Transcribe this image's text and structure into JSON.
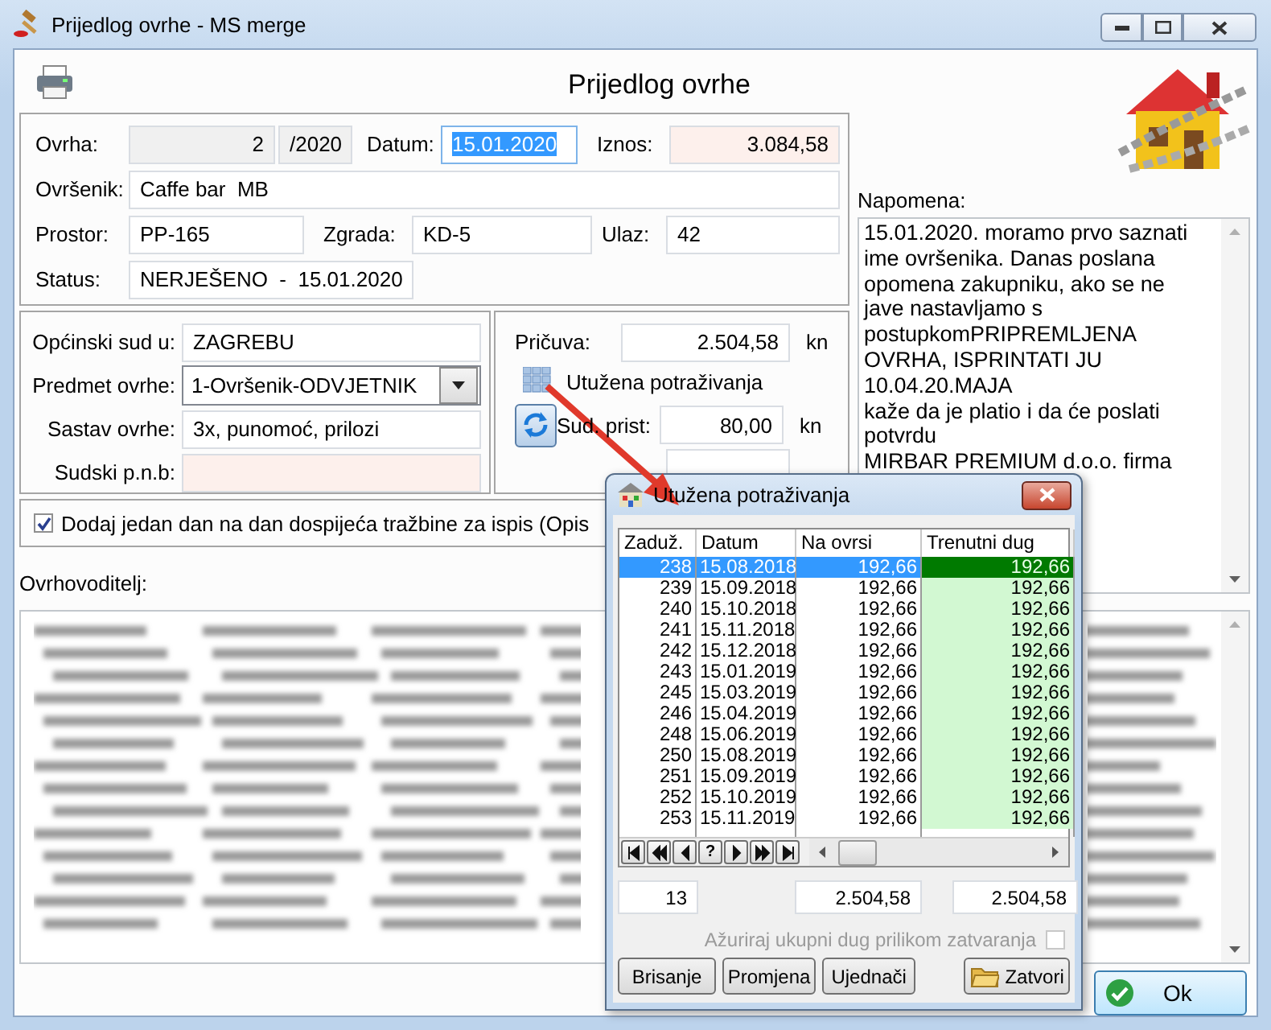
{
  "window": {
    "title": "Prijedlog ovrhe - MS merge"
  },
  "form_title": "Prijedlog ovrhe",
  "case": {
    "ovrha": {
      "label": "Ovrha:",
      "number": "2",
      "year": "/2020"
    },
    "datum": {
      "label": "Datum:",
      "value": "15.01.2020",
      "text_selected": true
    },
    "iznos": {
      "label": "Iznos:",
      "value": "3.084,58"
    },
    "ovrsenik": {
      "label": "Ovršenik:",
      "value": "Caffe bar  MB"
    },
    "prostor": {
      "label": "Prostor:",
      "value": "PP-165"
    },
    "zgrada": {
      "label": "Zgrada:",
      "value": "KD-5"
    },
    "ulaz": {
      "label": "Ulaz:",
      "value": "42"
    },
    "status": {
      "label": "Status:",
      "value": "NERJEŠENO  -  15.01.2020"
    }
  },
  "court": {
    "sud": {
      "label": "Općinski sud u:",
      "value": "ZAGREBU"
    },
    "predmet": {
      "label": "Predmet ovrhe:",
      "value": "1-Ovršenik-ODVJETNIK"
    },
    "sastav": {
      "label": "Sastav ovrhe:",
      "value": "3x, punomoć, prilozi"
    },
    "pnb": {
      "label": "Sudski p.n.b:"
    }
  },
  "costs": {
    "pricuva": {
      "label": "Pričuva:",
      "value": "2.504,58",
      "unit": "kn"
    },
    "link": "Utužena potraživanja",
    "sud_prist": {
      "label": "Sud. prist:",
      "value": "80,00",
      "unit": "kn"
    }
  },
  "add_day": {
    "label": "Dodaj jedan dan na dan dospijeća tražbine za ispis (Opis",
    "checked": true
  },
  "creditor_label": "Ovrhovoditelj:",
  "note": {
    "label": "Napomena:",
    "lines": [
      "15.01.2020. moramo prvo saznati",
      "ime ovršenika. Danas poslana",
      "opomena zakupniku, ako se ne",
      "jave nastavljamo s",
      "postupkomPRIPREMLJENA",
      "OVRHA, ISPRINTATI JU",
      "10.04.20.MAJA",
      "kaže da je platio i da će poslati",
      "potvrdu",
      "MIRBAR PREMIUM d.o.o. firma"
    ]
  },
  "ok_button": "Ok",
  "popup": {
    "title": "Utužena potraživanja",
    "columns": [
      "Zaduž.",
      "Datum",
      "Na ovrsi",
      "Trenutni dug"
    ],
    "rows": [
      {
        "zaduz": "238",
        "datum": "15.08.2018",
        "na_ovrsi": "192,66",
        "trenutni_dug": "192,66",
        "selected": true
      },
      {
        "zaduz": "239",
        "datum": "15.09.2018",
        "na_ovrsi": "192,66",
        "trenutni_dug": "192,66",
        "selected": false
      },
      {
        "zaduz": "240",
        "datum": "15.10.2018",
        "na_ovrsi": "192,66",
        "trenutni_dug": "192,66",
        "selected": false
      },
      {
        "zaduz": "241",
        "datum": "15.11.2018",
        "na_ovrsi": "192,66",
        "trenutni_dug": "192,66",
        "selected": false
      },
      {
        "zaduz": "242",
        "datum": "15.12.2018",
        "na_ovrsi": "192,66",
        "trenutni_dug": "192,66",
        "selected": false
      },
      {
        "zaduz": "243",
        "datum": "15.01.2019",
        "na_ovrsi": "192,66",
        "trenutni_dug": "192,66",
        "selected": false
      },
      {
        "zaduz": "245",
        "datum": "15.03.2019",
        "na_ovrsi": "192,66",
        "trenutni_dug": "192,66",
        "selected": false
      },
      {
        "zaduz": "246",
        "datum": "15.04.2019",
        "na_ovrsi": "192,66",
        "trenutni_dug": "192,66",
        "selected": false
      },
      {
        "zaduz": "248",
        "datum": "15.06.2019",
        "na_ovrsi": "192,66",
        "trenutni_dug": "192,66",
        "selected": false
      },
      {
        "zaduz": "250",
        "datum": "15.08.2019",
        "na_ovrsi": "192,66",
        "trenutni_dug": "192,66",
        "selected": false
      },
      {
        "zaduz": "251",
        "datum": "15.09.2019",
        "na_ovrsi": "192,66",
        "trenutni_dug": "192,66",
        "selected": false
      },
      {
        "zaduz": "252",
        "datum": "15.10.2019",
        "na_ovrsi": "192,66",
        "trenutni_dug": "192,66",
        "selected": false
      },
      {
        "zaduz": "253",
        "datum": "15.11.2019",
        "na_ovrsi": "192,66",
        "trenutni_dug": "192,66",
        "selected": false
      }
    ],
    "pager_help": "?",
    "totals": {
      "count": "13",
      "na_ovrsi": "2.504,58",
      "trenutni_dug": "2.504,58"
    },
    "update_option": {
      "label": "Ažuriraj ukupni dug prilikom zatvaranja",
      "checked": false,
      "disabled": true
    },
    "buttons": [
      {
        "kind": "plain",
        "label": "Brisanje"
      },
      {
        "kind": "plain",
        "label": "Promjena"
      },
      {
        "kind": "plain",
        "label": "Ujednači"
      },
      {
        "kind": "spacer_folder",
        "label": "Zatvori"
      }
    ]
  }
}
